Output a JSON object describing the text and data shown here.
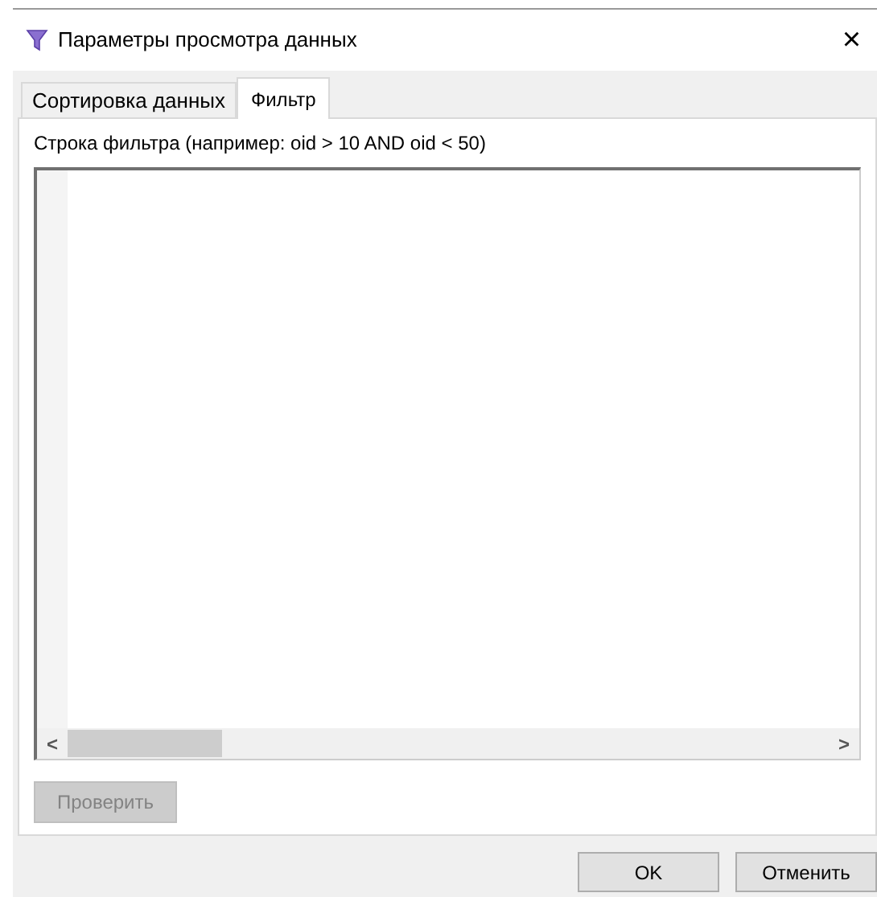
{
  "window": {
    "title": "Параметры просмотра данных",
    "close": "×"
  },
  "tabs": [
    {
      "label": "Сортировка данных",
      "selected": false
    },
    {
      "label": "Фильтр",
      "selected": true
    }
  ],
  "filter": {
    "label": "Строка фильтра (например: oid > 10 AND oid < 50)",
    "scroll_left": "<",
    "scroll_right": ">"
  },
  "check_button": {
    "label": "Проверить",
    "disabled": true
  },
  "buttons": [
    {
      "label": "OK"
    },
    {
      "label": "Отменить"
    }
  ]
}
